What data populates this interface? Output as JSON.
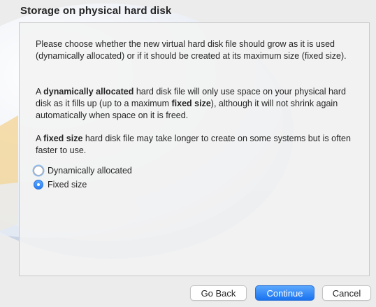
{
  "page": {
    "title": "Storage on physical hard disk"
  },
  "description": {
    "p1": "Please choose whether the new virtual hard disk file should grow as it is used (dynamically allocated) or if it should be created at its maximum size (fixed size).",
    "p2": {
      "t1": "A ",
      "b1": "dynamically allocated",
      "t2": " hard disk file will only use space on your physical hard disk as it fills up (up to a maximum ",
      "b2": "fixed size",
      "t3": "), although it will not shrink again automatically when space on it is freed."
    },
    "p3": {
      "t1": "A ",
      "b1": "fixed size",
      "t2": " hard disk file may take longer to create on some systems but is often faster to use."
    }
  },
  "options": {
    "dynamic": {
      "label": "Dynamically allocated",
      "selected": false
    },
    "fixed": {
      "label": "Fixed size",
      "selected": true
    }
  },
  "buttons": {
    "back": "Go Back",
    "continue": "Continue",
    "cancel": "Cancel"
  },
  "colors": {
    "accent": "#2c7ff2",
    "window_bg": "#ececec"
  }
}
